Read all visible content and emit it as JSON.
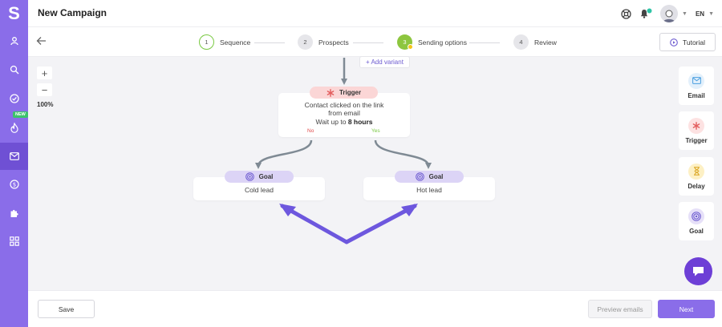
{
  "app": {
    "logo_letter": "S",
    "title": "New Campaign",
    "language": "EN"
  },
  "sidebar": {
    "items": [
      {
        "icon": "user-icon"
      },
      {
        "icon": "search-icon"
      },
      {
        "icon": "check-circle-icon"
      },
      {
        "icon": "flame-icon",
        "badge": "NEW"
      },
      {
        "icon": "mail-icon",
        "active": true
      },
      {
        "icon": "dollar-icon"
      },
      {
        "icon": "puzzle-icon"
      },
      {
        "icon": "grid-icon"
      }
    ]
  },
  "steps": [
    {
      "num": "1",
      "label": "Sequence",
      "state": "done"
    },
    {
      "num": "2",
      "label": "Prospects",
      "state": "todo"
    },
    {
      "num": "3",
      "label": "Sending options",
      "state": "current"
    },
    {
      "num": "4",
      "label": "Review",
      "state": "todo"
    }
  ],
  "tutorial_label": "Tutorial",
  "zoom": {
    "plus": "+",
    "minus": "−",
    "level": "100%"
  },
  "flow": {
    "add_variant": "+ Add variant",
    "trigger": {
      "label": "Trigger",
      "line1": "Contact clicked on the link",
      "line2": "from email",
      "wait_prefix": "Wait up to",
      "wait_value": "8 hours",
      "no_label": "No",
      "yes_label": "Yes"
    },
    "goals": [
      {
        "label": "Goal",
        "text": "Cold lead"
      },
      {
        "label": "Goal",
        "text": "Hot lead"
      }
    ]
  },
  "palette": [
    {
      "label": "Email",
      "icon": "mail-icon",
      "color": "#e3f0fb"
    },
    {
      "label": "Trigger",
      "icon": "asterisk-icon",
      "color": "#fde2e2"
    },
    {
      "label": "Delay",
      "icon": "hourglass-icon",
      "color": "#fdf0c4"
    },
    {
      "label": "Goal",
      "icon": "target-icon",
      "color": "#e6e0f8"
    }
  ],
  "footer": {
    "save": "Save",
    "preview": "Preview emails",
    "next": "Next"
  },
  "colors": {
    "accent": "#8a6de9",
    "sidebar_active": "#6f50d4",
    "success": "#7ac943",
    "trigger_pink": "#fbd6d6",
    "goal_lavender": "#dcd4f6"
  }
}
